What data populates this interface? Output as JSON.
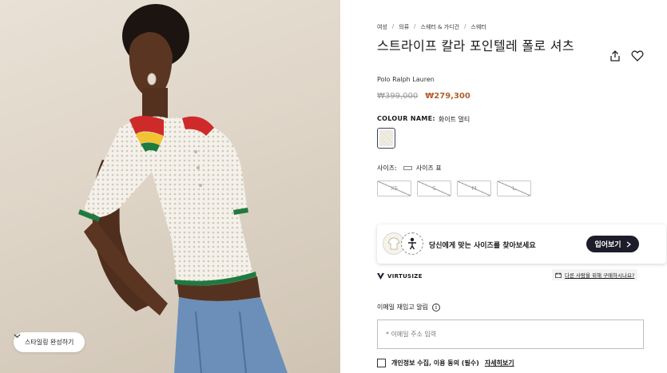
{
  "photo": {
    "styling_button_label": "스타일링 완성하기"
  },
  "breadcrumb": [
    "여성",
    "의류",
    "스웨터 & 가디건",
    "스웨터"
  ],
  "breadcrumb_separator": "/",
  "product": {
    "title": "스트라이프 칼라 포인텔레 폴로 셔츠",
    "brand": "Polo Ralph Lauren",
    "price_original": "₩399,000",
    "price_sale": "₩279,300",
    "colour_label": "COLOUR NAME:",
    "colour_value": "화이트 멀티",
    "size_label": "사이즈:",
    "size_chart_label": "사이즈 표",
    "sizes": [
      "XS",
      "S",
      "M",
      "L"
    ]
  },
  "virtusize": {
    "prompt": "당신에게 맞는 사이즈를 찾아보세요",
    "button_label": "입어보기",
    "logo_text": "VIRTUSIZE",
    "gift_link": "다른 사람을 위해 구매하시나요?"
  },
  "notify": {
    "label": "이메일 재입고 알림",
    "email_placeholder": "* 이메일 주소 입력",
    "consent_text": "개인정보 수집, 이용 동의 (필수)",
    "consent_more": "자세히보기"
  },
  "colors": {
    "sale_price": "#b3602f",
    "button_dark": "#1c1c2a",
    "swatch_border": "#3a3f5c"
  }
}
